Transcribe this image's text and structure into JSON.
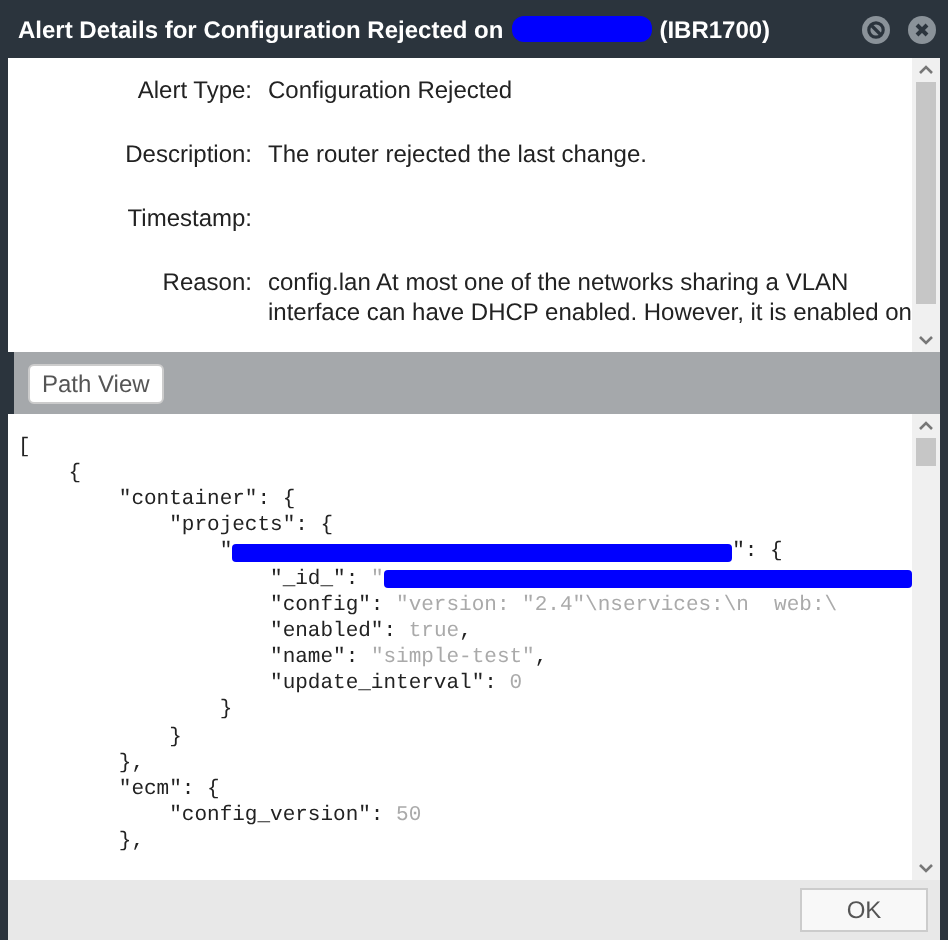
{
  "window": {
    "title_start": "Alert Details for Configuration Rejected on",
    "title_end": "(IBR1700)"
  },
  "details": [
    {
      "label": "Alert Type:",
      "value": "Configuration Rejected"
    },
    {
      "label": "Description:",
      "value": "The router rejected the last change."
    },
    {
      "label": "Timestamp:"
    },
    {
      "label": "Reason:",
      "value": "config.lan At most one of the networks sharing a VLAN\ninterface can have DHCP enabled. However, it is enabled on"
    }
  ],
  "path_view_button": "Path View",
  "code_lines": [
    [
      {
        "kind": "syntax",
        "text": "["
      }
    ],
    [
      {
        "kind": "syntax",
        "text": "    {"
      }
    ],
    [
      {
        "kind": "syntax",
        "text": "        \"container\": {"
      }
    ],
    [
      {
        "kind": "syntax",
        "text": "            \"projects\": {"
      }
    ],
    [
      {
        "kind": "syntax",
        "text": "                \""
      },
      {
        "kind": "redaction"
      },
      {
        "kind": "syntax",
        "text": "\": {"
      }
    ],
    [
      {
        "kind": "syntax",
        "text": "                    \"_id_\": "
      },
      {
        "kind": "value",
        "text": "\""
      },
      {
        "kind": "redaction"
      }
    ],
    [
      {
        "kind": "syntax",
        "text": "                    \"config\": "
      },
      {
        "kind": "value",
        "text": "\"version: \"2.4\"\\nservices:\\n  web:\\"
      }
    ],
    [
      {
        "kind": "syntax",
        "text": "                    \"enabled\": "
      },
      {
        "kind": "value",
        "text": "true"
      },
      {
        "kind": "syntax",
        "text": ","
      }
    ],
    [
      {
        "kind": "syntax",
        "text": "                    \"name\": "
      },
      {
        "kind": "value",
        "text": "\"simple-test\""
      },
      {
        "kind": "syntax",
        "text": ","
      }
    ],
    [
      {
        "kind": "syntax",
        "text": "                    \"update_interval\": "
      },
      {
        "kind": "value",
        "text": "0"
      }
    ],
    [
      {
        "kind": "syntax",
        "text": "                }"
      }
    ],
    [
      {
        "kind": "syntax",
        "text": "            }"
      }
    ],
    [
      {
        "kind": "syntax",
        "text": "        },"
      }
    ],
    [
      {
        "kind": "syntax",
        "text": "        \"ecm\": {"
      }
    ],
    [
      {
        "kind": "syntax",
        "text": "            \"config_version\": "
      },
      {
        "kind": "value",
        "text": "50"
      }
    ],
    [
      {
        "kind": "syntax",
        "text": "        },"
      }
    ]
  ],
  "ok_button": "OK"
}
